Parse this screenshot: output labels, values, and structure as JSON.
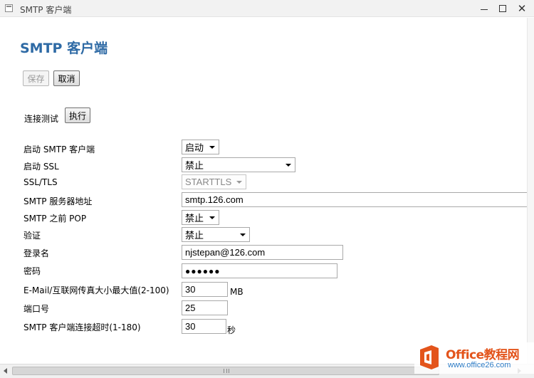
{
  "window": {
    "title": "SMTP 客户端",
    "minimize_symbol": "",
    "close_symbol": "✕"
  },
  "page": {
    "title": "SMTP 客户端"
  },
  "toolbar": {
    "save_label": "保存",
    "cancel_label": "取消"
  },
  "connection_test": {
    "label": "连接测试",
    "run_label": "执行"
  },
  "form": {
    "enable_smtp": {
      "label": "启动 SMTP 客户端",
      "value": "启动"
    },
    "enable_ssl": {
      "label": "启动 SSL",
      "value": "禁止"
    },
    "ssl_tls": {
      "label": "SSL/TLS",
      "value": "STARTTLS"
    },
    "server": {
      "label": "SMTP 服务器地址",
      "value": "smtp.126.com"
    },
    "pop_before": {
      "label": "SMTP 之前 POP",
      "value": "禁止"
    },
    "auth": {
      "label": "验证",
      "value": "禁止"
    },
    "login": {
      "label": "登录名",
      "value": "njstepan@126.com"
    },
    "password": {
      "label": "密码",
      "value": "●●●●●●"
    },
    "max_size": {
      "label": "E-Mail/互联网传真大小最大值(2-100)",
      "value": "30",
      "unit": "MB"
    },
    "port": {
      "label": "端口号",
      "value": "25"
    },
    "timeout": {
      "label": "SMTP 客户端连接超时(1-180)",
      "value": "30",
      "unit": "秒"
    }
  },
  "watermark": {
    "brand": "Office教程网",
    "url": "www.office26.com",
    "colors": {
      "orange": "#e3541b",
      "blue": "#2d7cc6"
    }
  },
  "colors": {
    "title_blue": "#2e6aa5"
  }
}
